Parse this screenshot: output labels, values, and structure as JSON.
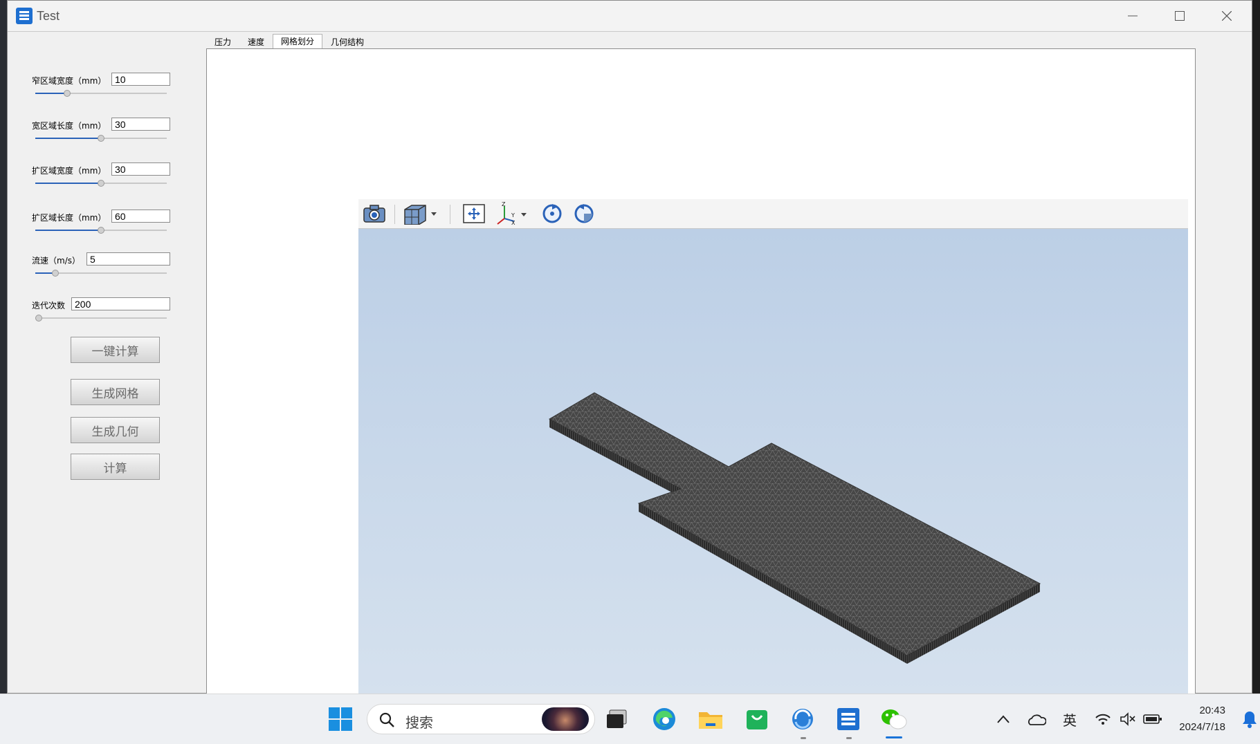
{
  "window": {
    "title": "Test"
  },
  "tabs": [
    {
      "label": "压力",
      "active": false
    },
    {
      "label": "速度",
      "active": false
    },
    {
      "label": "网格划分",
      "active": true
    },
    {
      "label": "几何结构",
      "active": false
    }
  ],
  "params": [
    {
      "label": "窄区域宽度（mm）",
      "value": "10",
      "slider_level": 0.24
    },
    {
      "label": "宽区域长度（mm）",
      "value": "30",
      "slider_level": 0.5
    },
    {
      "label": "扩区域宽度（mm）",
      "value": "30",
      "slider_level": 0.5
    },
    {
      "label": "扩区域长度（mm）",
      "value": "60",
      "slider_level": 0.5
    },
    {
      "label": "流速（m/s）",
      "value": "5",
      "slider_level": 0.15
    },
    {
      "label": "迭代次数",
      "value": "200",
      "slider_level": 0.0
    }
  ],
  "buttons": {
    "one_click": "一键计算",
    "gen_mesh": "生成网格",
    "gen_geom": "生成几何",
    "compute": "计算"
  },
  "viewer_toolbar": [
    "camera-icon",
    "view-cube-icon",
    "fit-all-icon",
    "axes-icon",
    "rotate-cw-icon",
    "rotate-ccw-icon"
  ],
  "taskbar": {
    "search_placeholder": "搜索",
    "ime": "英",
    "time": "20:43",
    "date": "2024/7/18"
  },
  "colors": {
    "accent": "#2a62b8",
    "view_bg_top": "#bccfe6",
    "mesh": "#4a4a4a"
  }
}
